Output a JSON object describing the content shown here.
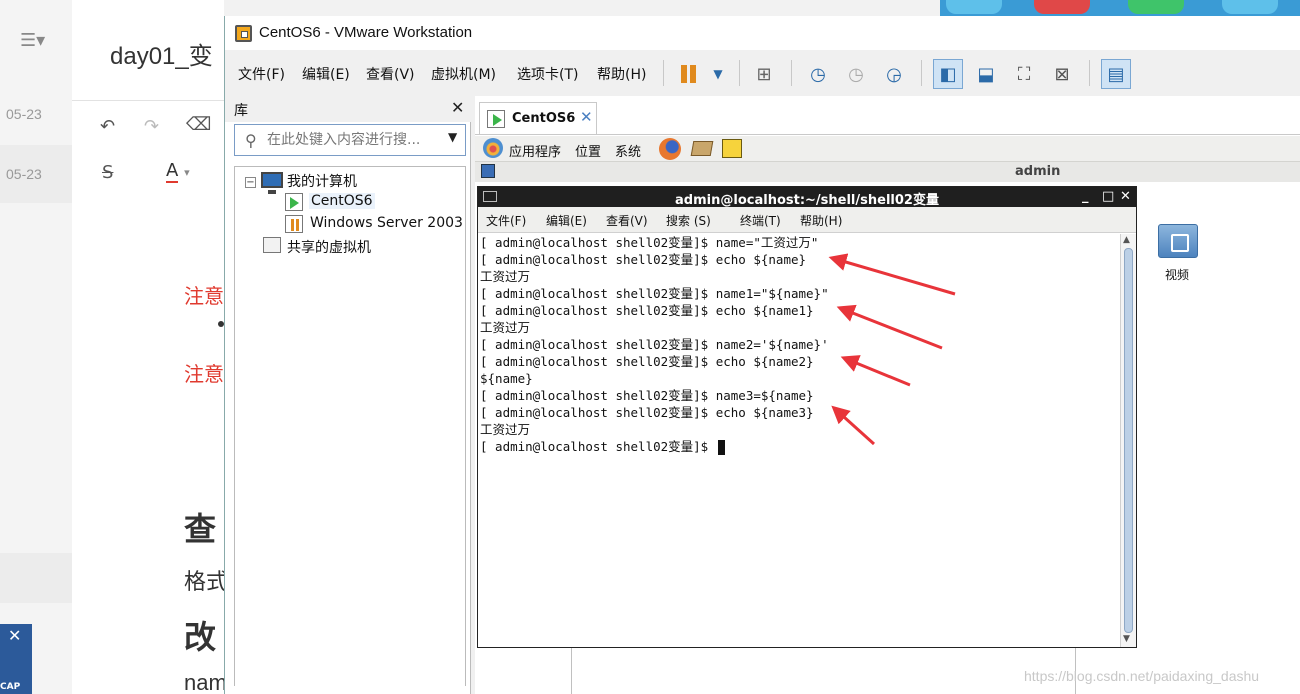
{
  "background_app": {
    "title": "day01_变",
    "dates": [
      "05-23",
      "05-23"
    ],
    "red_notes": [
      "注意",
      "注意"
    ],
    "bold_headings": [
      "查",
      "改"
    ],
    "texts": [
      "格式",
      "nam"
    ],
    "thumbnail_label": "CAP"
  },
  "window": {
    "title": "CentOS6 - VMware Workstation"
  },
  "menubar": {
    "items": [
      "文件(F)",
      "编辑(E)",
      "查看(V)",
      "虚拟机(M)",
      "选项卡(T)",
      "帮助(H)"
    ]
  },
  "library": {
    "title": "库",
    "search_placeholder": "在此处键入内容进行搜...",
    "tree": {
      "root": "我的计算机",
      "vms": [
        "CentOS6",
        "Windows Server 2003"
      ],
      "shared": "共享的虚拟机"
    }
  },
  "vm_tab": {
    "label": "CentOS6"
  },
  "guest": {
    "panel_items": [
      "应用程序",
      "位置",
      "系统"
    ],
    "user": "admin",
    "desktop_icon_label": "视频"
  },
  "terminal": {
    "title": "admin@localhost:~/shell/shell02变量",
    "menu": [
      "文件(F)",
      "编辑(E)",
      "查看(V)",
      "搜索 (S)",
      "终端(T)",
      "帮助(H)"
    ],
    "lines": [
      "[ admin@localhost shell02变量]$ name=\"工资过万\"",
      "[ admin@localhost shell02变量]$ echo ${name}",
      "工资过万",
      "[ admin@localhost shell02变量]$ name1=\"${name}\"",
      "[ admin@localhost shell02变量]$ echo ${name1}",
      "工资过万",
      "[ admin@localhost shell02变量]$ name2='${name}'",
      "[ admin@localhost shell02变量]$ echo ${name2}",
      "${name}",
      "[ admin@localhost shell02变量]$ name3=${name}",
      "[ admin@localhost shell02变量]$ echo ${name3}",
      "工资过万"
    ],
    "prompt": "[ admin@localhost shell02变量]$ "
  },
  "watermark": "https://blog.csdn.net/paidaxing_dashu",
  "colors": {
    "annotation_arrow": "#e8343a",
    "terminal_title_bg": "#1f1f1f",
    "active_toolbar": "#cfe3f5"
  }
}
